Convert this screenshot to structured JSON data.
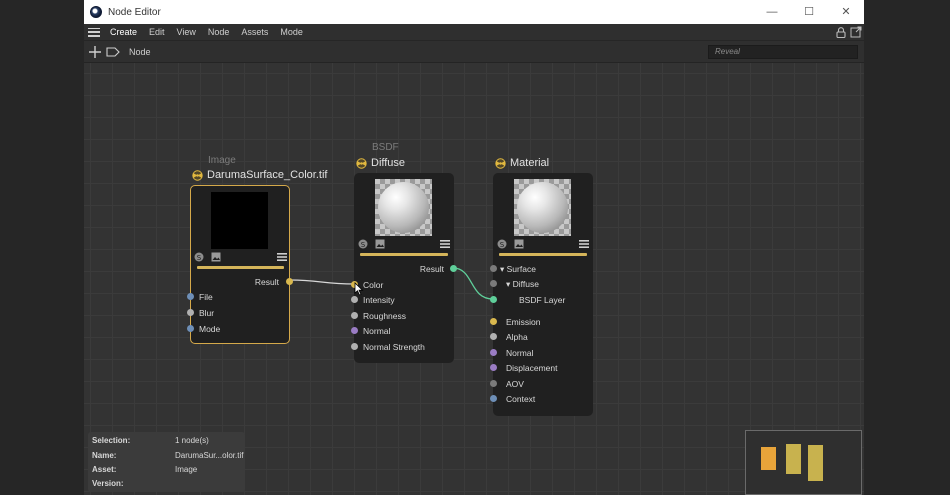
{
  "window": {
    "title": "Node Editor",
    "minimize": "—",
    "maximize": "☐",
    "close": "✕"
  },
  "menu": [
    "Create",
    "Edit",
    "View",
    "Node",
    "Assets",
    "Mode"
  ],
  "toolbar": {
    "breadcrumb": "Node",
    "reveal_placeholder": "Reveal"
  },
  "nodes": {
    "image": {
      "category": "Image",
      "title": "DarumaSurface_Color.tif",
      "output": "Result",
      "inputs": [
        "File",
        "Blur",
        "Mode"
      ]
    },
    "diffuse": {
      "category": "BSDF",
      "title": "Diffuse",
      "output": "Result",
      "inputs": [
        "Color",
        "Intensity",
        "Roughness",
        "Normal",
        "Normal Strength"
      ]
    },
    "material": {
      "title": "Material",
      "surface": "Surface",
      "diffuse": "Diffuse",
      "bsdf_layer": "BSDF Layer",
      "inputs": [
        "Emission",
        "Alpha",
        "Normal",
        "Displacement",
        "AOV",
        "Context"
      ]
    }
  },
  "info": {
    "selection_label": "Selection:",
    "selection_value": "1 node(s)",
    "name_label": "Name:",
    "name_value": "DarumaSur...olor.tif",
    "asset_label": "Asset:",
    "asset_value": "Image",
    "version_label": "Version:",
    "version_value": ""
  },
  "colors": {
    "accent": "#d5b55a",
    "selected_border": "#d5a94a",
    "wire_teal": "#5fcf9a"
  }
}
